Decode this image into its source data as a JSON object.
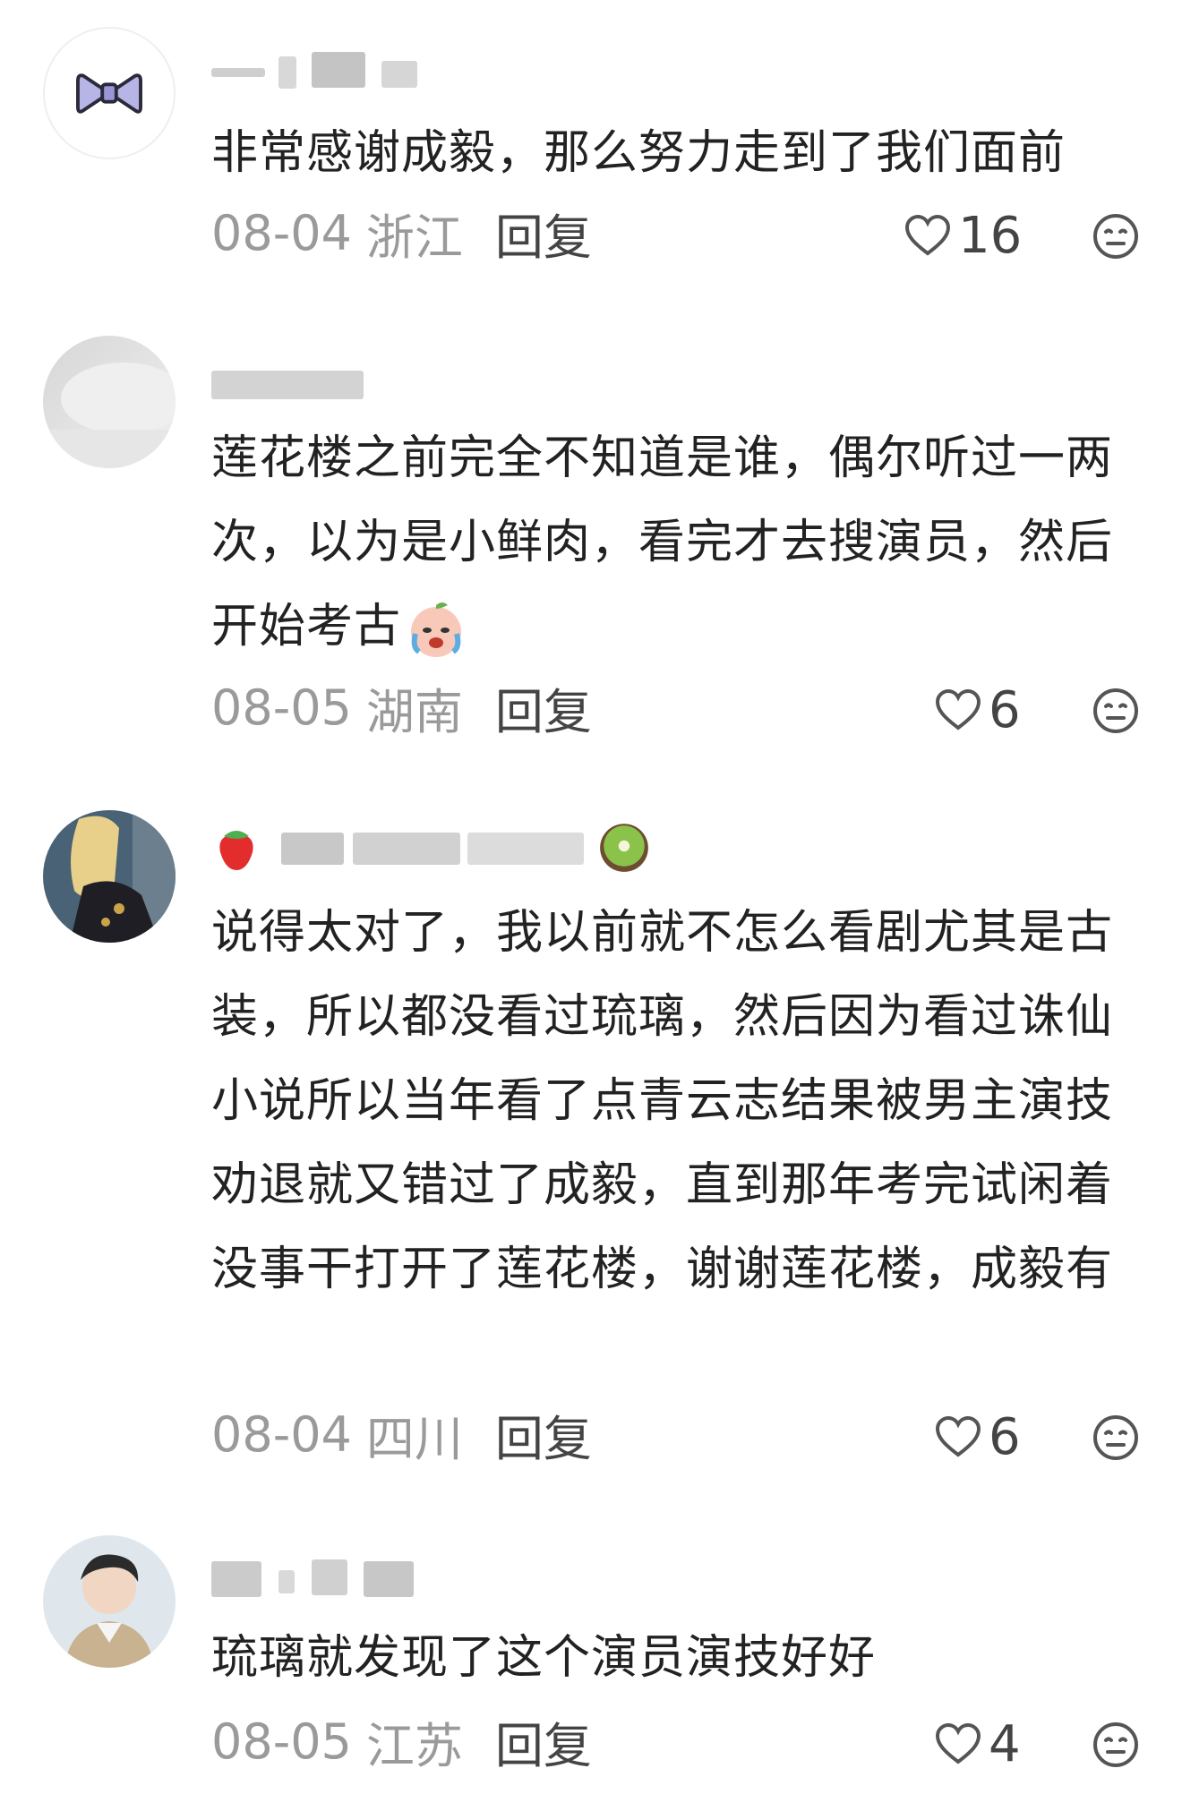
{
  "comments": [
    {
      "avatar": "bow-icon",
      "text": "非常感谢成毅，那么努力走到了我们面前",
      "date": "08-04",
      "region": "浙江",
      "reply": "回复",
      "likes": "16"
    },
    {
      "avatar": "cloud-photo",
      "text": "莲花楼之前完全不知道是谁，偶尔听过一两次，以为是小鲜肉，看完才去搜演员，然后开始考古",
      "emoji": "crying-peach-emoji",
      "date": "08-05",
      "region": "湖南",
      "reply": "回复",
      "likes": "6"
    },
    {
      "avatar": "blonde-person-photo",
      "username_emojis": [
        "strawberry-emoji",
        "kiwi-emoji"
      ],
      "text": "说得太对了，我以前就不怎么看剧尤其是古装，所以都没看过琉璃，然后因为看过诛仙小说所以当年看了点青云志结果被男主演技劝退就又错过了成毅，直到那年考完试闲着没事干打开了莲花楼，谢谢莲花楼，成毅有实力迟早会被人看见的",
      "date": "08-04",
      "region": "四川",
      "reply": "回复",
      "likes": "6"
    },
    {
      "avatar": "young-man-photo",
      "text": "琉璃就发现了这个演员演技好好",
      "date": "08-05",
      "region": "江苏",
      "reply": "回复",
      "likes": "4"
    }
  ],
  "icons": {
    "like": "heart-outline-icon",
    "react": "neutral-face-icon"
  },
  "colors": {
    "text": "#222222",
    "meta": "#9a9a9a",
    "action": "#444444"
  }
}
